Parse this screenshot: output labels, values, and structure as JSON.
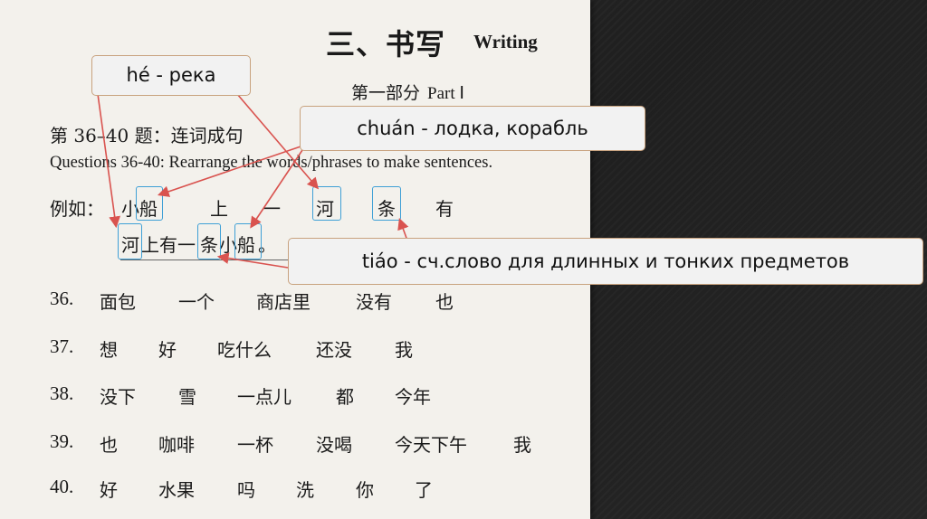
{
  "header": {
    "title_cn": "三、书写",
    "title_en": "Writing",
    "part_cn": "第一部分",
    "part_en": "Part Ⅰ"
  },
  "instructions": {
    "cn": "第 36–40 题：连词成句",
    "en": "Questions 36-40: Rearrange the words/phrases to make sentences."
  },
  "example": {
    "label": "例如：",
    "words": [
      "小船",
      "上",
      "一",
      "河",
      "条",
      "有"
    ],
    "answer": [
      "河",
      "上有一",
      "条",
      "小船",
      "。"
    ]
  },
  "questions": [
    {
      "num": "36.",
      "words": [
        "面包",
        "一个",
        "商店里",
        "没有",
        "也"
      ]
    },
    {
      "num": "37.",
      "words": [
        "想",
        "好",
        "吃什么",
        "还没",
        "我"
      ]
    },
    {
      "num": "38.",
      "words": [
        "没下",
        "雪",
        "一点儿",
        "都",
        "今年"
      ]
    },
    {
      "num": "39.",
      "words": [
        "也",
        "咖啡",
        "一杯",
        "没喝",
        "今天下午",
        "我"
      ]
    },
    {
      "num": "40.",
      "words": [
        "好",
        "水果",
        "吗",
        "洗",
        "你",
        "了"
      ]
    }
  ],
  "callouts": {
    "he": "hé - река",
    "chuan": "chuán - лодка, корабль",
    "tiao": "tiáo - сч.слово для длинных и тонких предметов"
  },
  "colors": {
    "box": "#3fa0d6",
    "callout_border": "#c8a27e",
    "arrow": "#d9534f"
  }
}
